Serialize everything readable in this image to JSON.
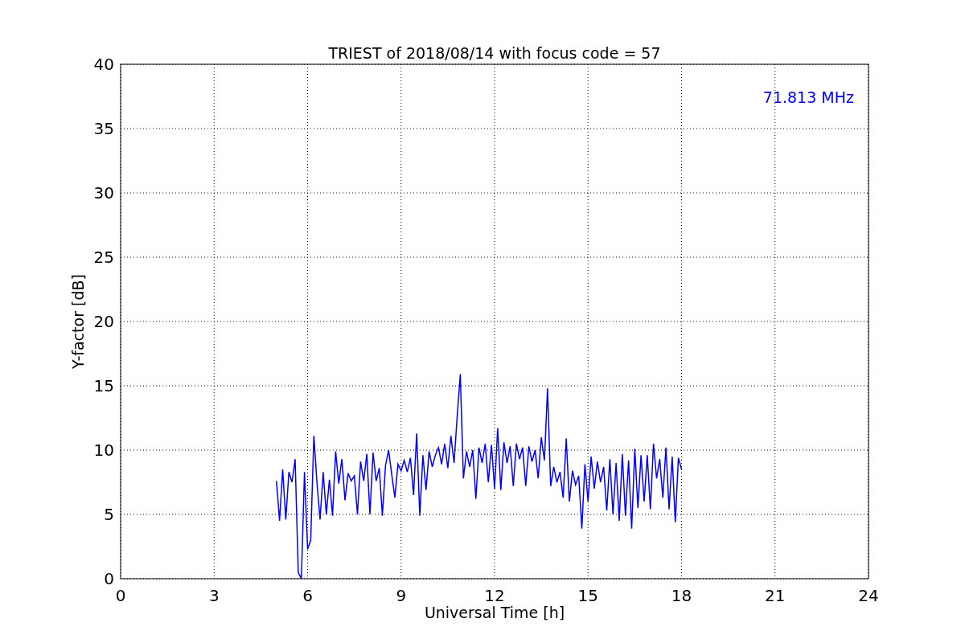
{
  "figure": {
    "chart_data": {
      "type": "line",
      "title": "TRIEST of 2018/08/14 with focus code = 57",
      "xlabel": "Universal Time [h]",
      "ylabel": "Y-factor [dB]",
      "xlim": [
        0,
        24
      ],
      "ylim": [
        0,
        40
      ],
      "xticks": [
        0,
        3,
        6,
        9,
        12,
        15,
        18,
        21,
        24
      ],
      "yticks": [
        0,
        5,
        10,
        15,
        20,
        25,
        30,
        35,
        40
      ],
      "grid": true,
      "annotations": [
        "71.813 MHz"
      ],
      "x": [
        5.0,
        5.1,
        5.2,
        5.3,
        5.4,
        5.5,
        5.6,
        5.7,
        5.8,
        5.9,
        6.0,
        6.1,
        6.2,
        6.3,
        6.4,
        6.5,
        6.6,
        6.7,
        6.8,
        6.9,
        7.0,
        7.1,
        7.2,
        7.3,
        7.4,
        7.5,
        7.6,
        7.7,
        7.8,
        7.9,
        8.0,
        8.1,
        8.2,
        8.3,
        8.4,
        8.5,
        8.6,
        8.7,
        8.8,
        8.9,
        9.0,
        9.1,
        9.2,
        9.3,
        9.4,
        9.5,
        9.6,
        9.7,
        9.8,
        9.9,
        10.0,
        10.1,
        10.2,
        10.3,
        10.4,
        10.5,
        10.6,
        10.7,
        10.8,
        10.9,
        11.0,
        11.1,
        11.2,
        11.3,
        11.4,
        11.5,
        11.6,
        11.7,
        11.8,
        11.9,
        12.0,
        12.1,
        12.2,
        12.3,
        12.4,
        12.5,
        12.6,
        12.7,
        12.8,
        12.9,
        13.0,
        13.1,
        13.2,
        13.3,
        13.4,
        13.5,
        13.6,
        13.7,
        13.8,
        13.9,
        14.0,
        14.1,
        14.2,
        14.3,
        14.4,
        14.5,
        14.6,
        14.7,
        14.8,
        14.9,
        15.0,
        15.1,
        15.2,
        15.3,
        15.4,
        15.5,
        15.6,
        15.7,
        15.8,
        15.9,
        16.0,
        16.1,
        16.2,
        16.3,
        16.4,
        16.5,
        16.6,
        16.7,
        16.8,
        16.9,
        17.0,
        17.1,
        17.2,
        17.3,
        17.4,
        17.5,
        17.6,
        17.7,
        17.8,
        17.9,
        18.0
      ],
      "series": [
        {
          "color": "#0000ff",
          "values": [
            7.6,
            4.5,
            8.5,
            4.6,
            8.3,
            7.5,
            9.3,
            0.5,
            0.0,
            8.3,
            2.3,
            3.0,
            11.1,
            7.5,
            4.6,
            8.3,
            5.0,
            7.7,
            4.9,
            9.9,
            7.4,
            9.3,
            6.1,
            8.2,
            7.6,
            8.0,
            5.0,
            9.1,
            7.6,
            9.7,
            5.0,
            9.8,
            7.6,
            8.6,
            4.9,
            8.8,
            10.0,
            8.1,
            6.3,
            8.9,
            8.4,
            9.2,
            8.3,
            9.4,
            6.5,
            11.3,
            4.9,
            9.6,
            6.9,
            9.9,
            8.7,
            9.6,
            10.2,
            8.9,
            10.5,
            8.6,
            11.1,
            9.0,
            12.6,
            15.9,
            7.8,
            9.9,
            8.7,
            10.0,
            6.2,
            10.2,
            9.0,
            10.5,
            7.5,
            10.4,
            7.0,
            11.7,
            6.9,
            10.6,
            9.0,
            10.3,
            7.2,
            10.5,
            9.3,
            10.2,
            7.2,
            10.3,
            9.1,
            10.0,
            7.8,
            11.0,
            9.2,
            14.8,
            7.2,
            8.7,
            7.5,
            8.3,
            6.3,
            10.9,
            6.0,
            8.4,
            7.3,
            8.0,
            3.9,
            8.9,
            6.0,
            9.5,
            7.0,
            9.1,
            7.5,
            8.7,
            5.3,
            9.3,
            5.0,
            9.0,
            4.5,
            9.7,
            4.9,
            9.2,
            3.9,
            10.1,
            5.5,
            9.6,
            6.0,
            9.6,
            5.4,
            10.5,
            7.8,
            9.3,
            6.3,
            10.2,
            5.4,
            9.5,
            4.4,
            9.4,
            8.5
          ]
        }
      ]
    }
  }
}
